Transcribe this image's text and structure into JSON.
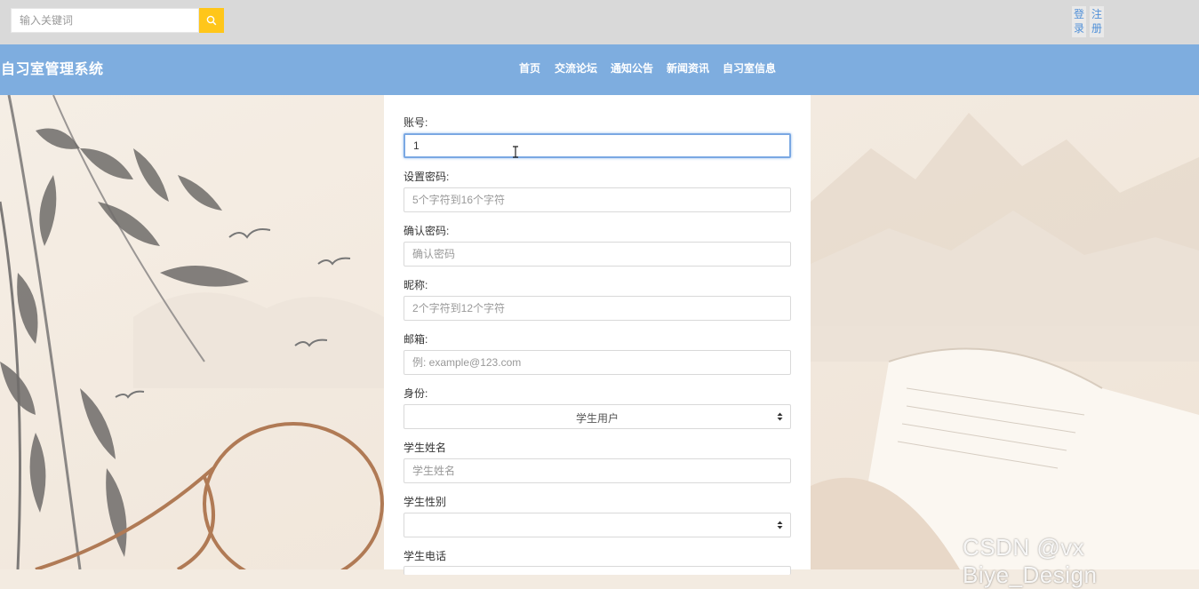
{
  "header": {
    "search": {
      "placeholder": "输入关键词"
    },
    "auth": {
      "login_top": "登",
      "login_bottom": "录",
      "register_top": "注",
      "register_bottom": "册"
    }
  },
  "navbar": {
    "brand": "自习室管理系统",
    "items": [
      {
        "label": "首页"
      },
      {
        "label": "交流论坛"
      },
      {
        "label": "通知公告"
      },
      {
        "label": "新闻资讯"
      },
      {
        "label": "自习室信息"
      }
    ]
  },
  "form": {
    "account": {
      "label": "账号:",
      "value": "1"
    },
    "password": {
      "label": "设置密码:",
      "placeholder": "5个字符到16个字符"
    },
    "confirm": {
      "label": "确认密码:",
      "placeholder": "确认密码"
    },
    "nickname": {
      "label": "昵称:",
      "placeholder": "2个字符到12个字符"
    },
    "email": {
      "label": "邮箱:",
      "placeholder": "例: example@123.com"
    },
    "role": {
      "label": "身份:",
      "selected": "学生用户"
    },
    "student_name": {
      "label": "学生姓名",
      "placeholder": "学生姓名"
    },
    "gender": {
      "label": "学生性别",
      "selected": ""
    },
    "phone": {
      "label": "学生电话"
    }
  },
  "watermark": "CSDN @vx Biye_Design",
  "colors": {
    "topbar": "#d9d9d9",
    "navbar": "#7eaddf",
    "search_button": "#ffc61a",
    "auth_text": "#4f8fd7"
  }
}
